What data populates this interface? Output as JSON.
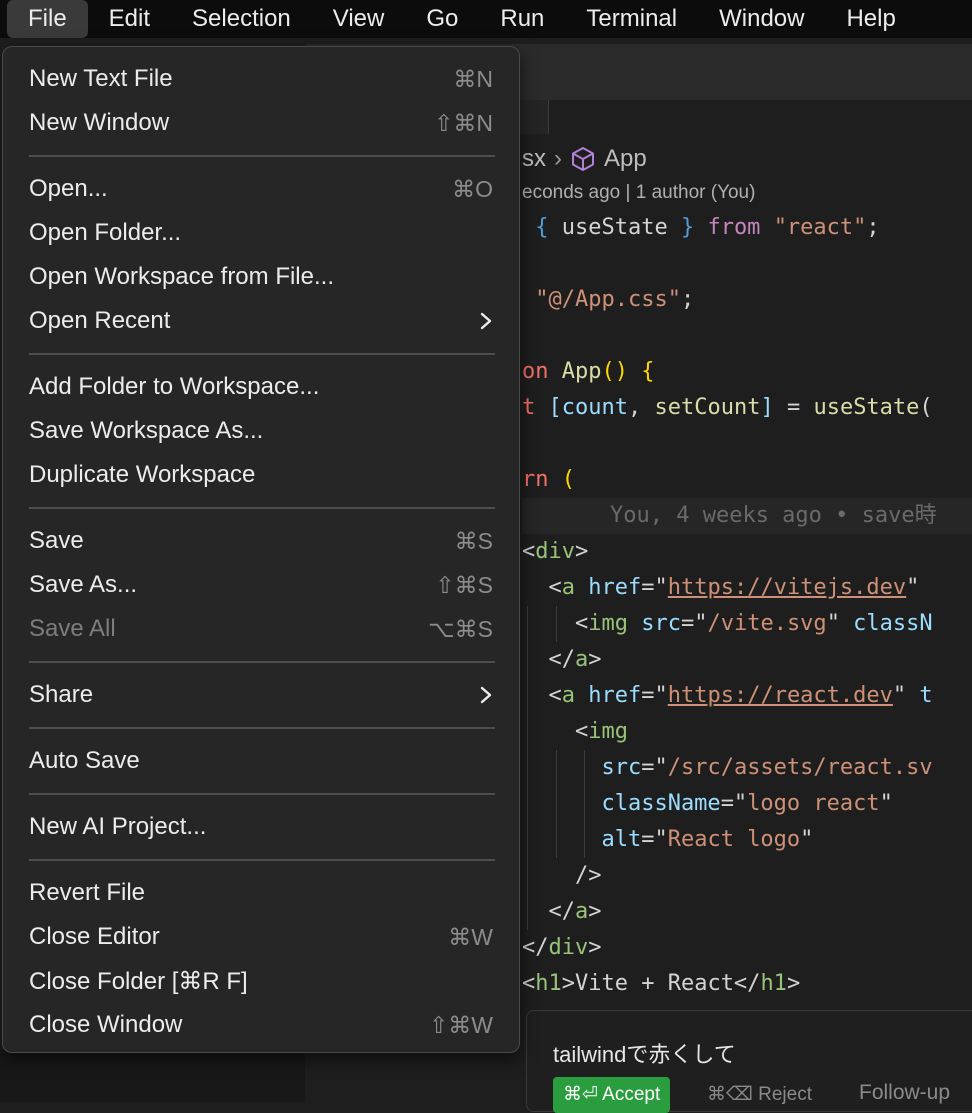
{
  "menubar": {
    "items": [
      "File",
      "Edit",
      "Selection",
      "View",
      "Go",
      "Run",
      "Terminal",
      "Window",
      "Help"
    ]
  },
  "editor": {
    "breadcrumb": {
      "file_fragment": "sx",
      "symbol": "App"
    },
    "blame_text": "econds ago | 1 author (You)",
    "inline_blame": "You, 4 weeks ago • save時",
    "code_lines": [
      {
        "segments": [
          [
            "pl",
            " "
          ],
          [
            "kb",
            "{"
          ],
          [
            "pl",
            " useState "
          ],
          [
            "kb",
            "}"
          ],
          [
            "k",
            " from "
          ],
          [
            "st",
            "\"react\""
          ],
          [
            "pl",
            ";"
          ]
        ]
      },
      {
        "segments": []
      },
      {
        "segments": [
          [
            "pl",
            " "
          ],
          [
            "st",
            "\"@/App.css\""
          ],
          [
            "pl",
            ";"
          ]
        ]
      },
      {
        "segments": []
      },
      {
        "segments": [
          [
            "kr",
            "on "
          ],
          [
            "fn",
            "App"
          ],
          [
            "yl",
            "()"
          ],
          [
            "pl",
            " "
          ],
          [
            "yl",
            "{"
          ]
        ]
      },
      {
        "segments": [
          [
            "kr",
            "t "
          ],
          [
            "vr",
            "[count"
          ],
          [
            "pl",
            ", "
          ],
          [
            "fn",
            "setCount"
          ],
          [
            "vr",
            "]"
          ],
          [
            "pl",
            " = "
          ],
          [
            "fn",
            "useState"
          ],
          [
            "pl",
            "("
          ]
        ]
      },
      {
        "segments": []
      },
      {
        "segments": [
          [
            "kr",
            "rn "
          ],
          [
            "yl",
            "("
          ]
        ]
      },
      {
        "segments": []
      },
      {
        "segments": [
          [
            "pl",
            "<"
          ],
          [
            "tgv",
            "div"
          ],
          [
            "pl",
            ">"
          ]
        ]
      },
      {
        "segments": [
          [
            "pl",
            "  <"
          ],
          [
            "tgv",
            "a"
          ],
          [
            "at",
            " href"
          ],
          [
            "pl",
            "=\""
          ],
          [
            "sv ul",
            "https://vitejs.dev"
          ],
          [
            "pl",
            "\""
          ]
        ]
      },
      {
        "segments": [
          [
            "pl",
            "    <"
          ],
          [
            "tgv",
            "img"
          ],
          [
            "at",
            " src"
          ],
          [
            "pl",
            "=\""
          ],
          [
            "sv",
            "/vite.svg"
          ],
          [
            "pl",
            "\""
          ],
          [
            "at",
            " classN"
          ]
        ]
      },
      {
        "segments": [
          [
            "pl",
            "  </"
          ],
          [
            "tgv",
            "a"
          ],
          [
            "pl",
            ">"
          ]
        ]
      },
      {
        "segments": [
          [
            "pl",
            "  <"
          ],
          [
            "tgv",
            "a"
          ],
          [
            "at",
            " href"
          ],
          [
            "pl",
            "=\""
          ],
          [
            "sv ul",
            "https://react.dev"
          ],
          [
            "pl",
            "\""
          ],
          [
            "at",
            " t"
          ]
        ]
      },
      {
        "segments": [
          [
            "pl",
            "    <"
          ],
          [
            "tgv",
            "img"
          ]
        ]
      },
      {
        "segments": [
          [
            "at",
            "      src"
          ],
          [
            "pl",
            "=\""
          ],
          [
            "sv",
            "/src/assets/react.sv"
          ]
        ]
      },
      {
        "segments": [
          [
            "at",
            "      className"
          ],
          [
            "pl",
            "=\""
          ],
          [
            "sv",
            "logo react"
          ],
          [
            "pl",
            "\""
          ]
        ]
      },
      {
        "segments": [
          [
            "at",
            "      alt"
          ],
          [
            "pl",
            "=\""
          ],
          [
            "sv",
            "React logo"
          ],
          [
            "pl",
            "\""
          ]
        ]
      },
      {
        "segments": [
          [
            "pl",
            "    />"
          ]
        ]
      },
      {
        "segments": [
          [
            "pl",
            "  </"
          ],
          [
            "tgv",
            "a"
          ],
          [
            "pl",
            ">"
          ]
        ]
      },
      {
        "segments": [
          [
            "pl",
            "</"
          ],
          [
            "tgv",
            "div"
          ],
          [
            "pl",
            ">"
          ]
        ]
      },
      {
        "segments": [
          [
            "pl",
            "<"
          ],
          [
            "tgv",
            "h1"
          ],
          [
            "pl",
            ">Vite + React</"
          ],
          [
            "tgv",
            "h1"
          ],
          [
            "pl",
            ">"
          ]
        ]
      }
    ]
  },
  "ai_popup": {
    "prompt": "tailwindで赤くして",
    "accept_label": "⌘⏎ Accept",
    "reject_label": "⌘⌫ Reject",
    "followup_label": "Follow-up"
  },
  "file_menu": {
    "items": [
      {
        "label": "New Text File",
        "shortcut": "⌘N",
        "name": "menu-item-new-text-file"
      },
      {
        "label": "New Window",
        "shortcut": "⇧⌘N",
        "name": "menu-item-new-window"
      },
      {
        "separator": true
      },
      {
        "label": "Open...",
        "shortcut": "⌘O",
        "name": "menu-item-open"
      },
      {
        "label": "Open Folder...",
        "shortcut": "",
        "name": "menu-item-open-folder"
      },
      {
        "label": "Open Workspace from File...",
        "shortcut": "",
        "name": "menu-item-open-workspace"
      },
      {
        "label": "Open Recent",
        "submenu": true,
        "name": "menu-item-open-recent"
      },
      {
        "separator": true
      },
      {
        "label": "Add Folder to Workspace...",
        "shortcut": "",
        "name": "menu-item-add-folder"
      },
      {
        "label": "Save Workspace As...",
        "shortcut": "",
        "name": "menu-item-save-workspace-as"
      },
      {
        "label": "Duplicate Workspace",
        "shortcut": "",
        "name": "menu-item-duplicate-workspace"
      },
      {
        "separator": true
      },
      {
        "label": "Save",
        "shortcut": "⌘S",
        "name": "menu-item-save"
      },
      {
        "label": "Save As...",
        "shortcut": "⇧⌘S",
        "name": "menu-item-save-as"
      },
      {
        "label": "Save All",
        "shortcut": "⌥⌘S",
        "disabled": true,
        "name": "menu-item-save-all"
      },
      {
        "separator": true
      },
      {
        "label": "Share",
        "submenu": true,
        "name": "menu-item-share"
      },
      {
        "separator": true
      },
      {
        "label": "Auto Save",
        "shortcut": "",
        "name": "menu-item-auto-save"
      },
      {
        "separator": true
      },
      {
        "label": "New AI Project...",
        "shortcut": "",
        "name": "menu-item-new-ai-project"
      },
      {
        "separator": true
      },
      {
        "label": "Revert File",
        "shortcut": "",
        "name": "menu-item-revert-file"
      },
      {
        "label": "Close Editor",
        "shortcut": "⌘W",
        "name": "menu-item-close-editor"
      },
      {
        "label": "Close Folder [⌘R F]",
        "shortcut": "",
        "name": "menu-item-close-folder"
      },
      {
        "label": "Close Window",
        "shortcut": "⇧⌘W",
        "name": "menu-item-close-window"
      }
    ]
  }
}
